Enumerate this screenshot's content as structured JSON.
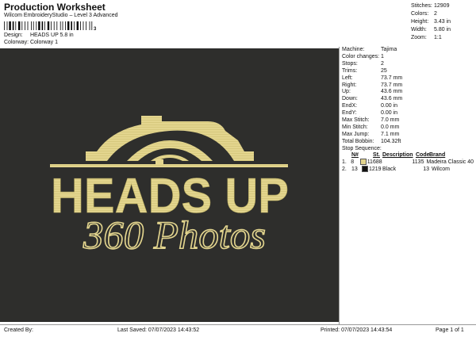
{
  "header": {
    "title": "Production Worksheet",
    "subtitle": "Wilcom EmbroideryStudio – Level 3 Advanced",
    "barcode_number": "3",
    "design_label": "Design:",
    "design_value": "HEADS UP 5.8 in",
    "colorway_label": "Colorway:",
    "colorway_value": "Colorway 1"
  },
  "stats": [
    {
      "label": "Stitches:",
      "value": "12909"
    },
    {
      "label": "Colors:",
      "value": "2"
    },
    {
      "label": "Height:",
      "value": "3.43 in"
    },
    {
      "label": "Width:",
      "value": "5.80 in"
    },
    {
      "label": "Zoom:",
      "value": "1:1"
    }
  ],
  "design_preview": {
    "line1": "HEADS UP",
    "line2": "360 Photos",
    "thread_color": "#e3d58e",
    "background_color": "#2e2e2c"
  },
  "machine_info": [
    {
      "label": "Machine:",
      "value": "Tajima"
    },
    {
      "label": "Color changes:",
      "value": "1"
    },
    {
      "label": "Stops:",
      "value": "2"
    },
    {
      "label": "Trims:",
      "value": "25"
    },
    {
      "label": "Left:",
      "value": "73.7 mm"
    },
    {
      "label": "Right:",
      "value": "73.7 mm"
    },
    {
      "label": "Up:",
      "value": "43.6 mm"
    },
    {
      "label": "Down:",
      "value": "43.6 mm"
    },
    {
      "label": "EndX:",
      "value": "0.00 in"
    },
    {
      "label": "EndY:",
      "value": "0.00 in"
    },
    {
      "label": "Max Stitch:",
      "value": "7.0 mm"
    },
    {
      "label": "Min Stitch:",
      "value": "0.0 mm"
    },
    {
      "label": "Max Jump:",
      "value": "7.1 mm"
    },
    {
      "label": "Total Bobbin:",
      "value": "104.32ft"
    }
  ],
  "stop_sequence": {
    "title": "Stop Sequence:",
    "headers": [
      "N#",
      "St.",
      "Description",
      "Code",
      "Brand"
    ],
    "rows": [
      {
        "index": "1.",
        "n": "8",
        "color": "#e3d58e",
        "st": "11688",
        "description": "",
        "code": "1135",
        "brand": "Madeira Classic 40"
      },
      {
        "index": "2.",
        "n": "13",
        "color": "#111111",
        "st": "1219",
        "description": "Black",
        "code": "13",
        "brand": "Wilcom"
      }
    ]
  },
  "footer": {
    "created_by": "Created By:",
    "last_saved": "Last Saved: 07/07/2023 14:43:52",
    "printed": "Printed: 07/07/2023 14:43:54",
    "page": "Page 1 of 1"
  }
}
